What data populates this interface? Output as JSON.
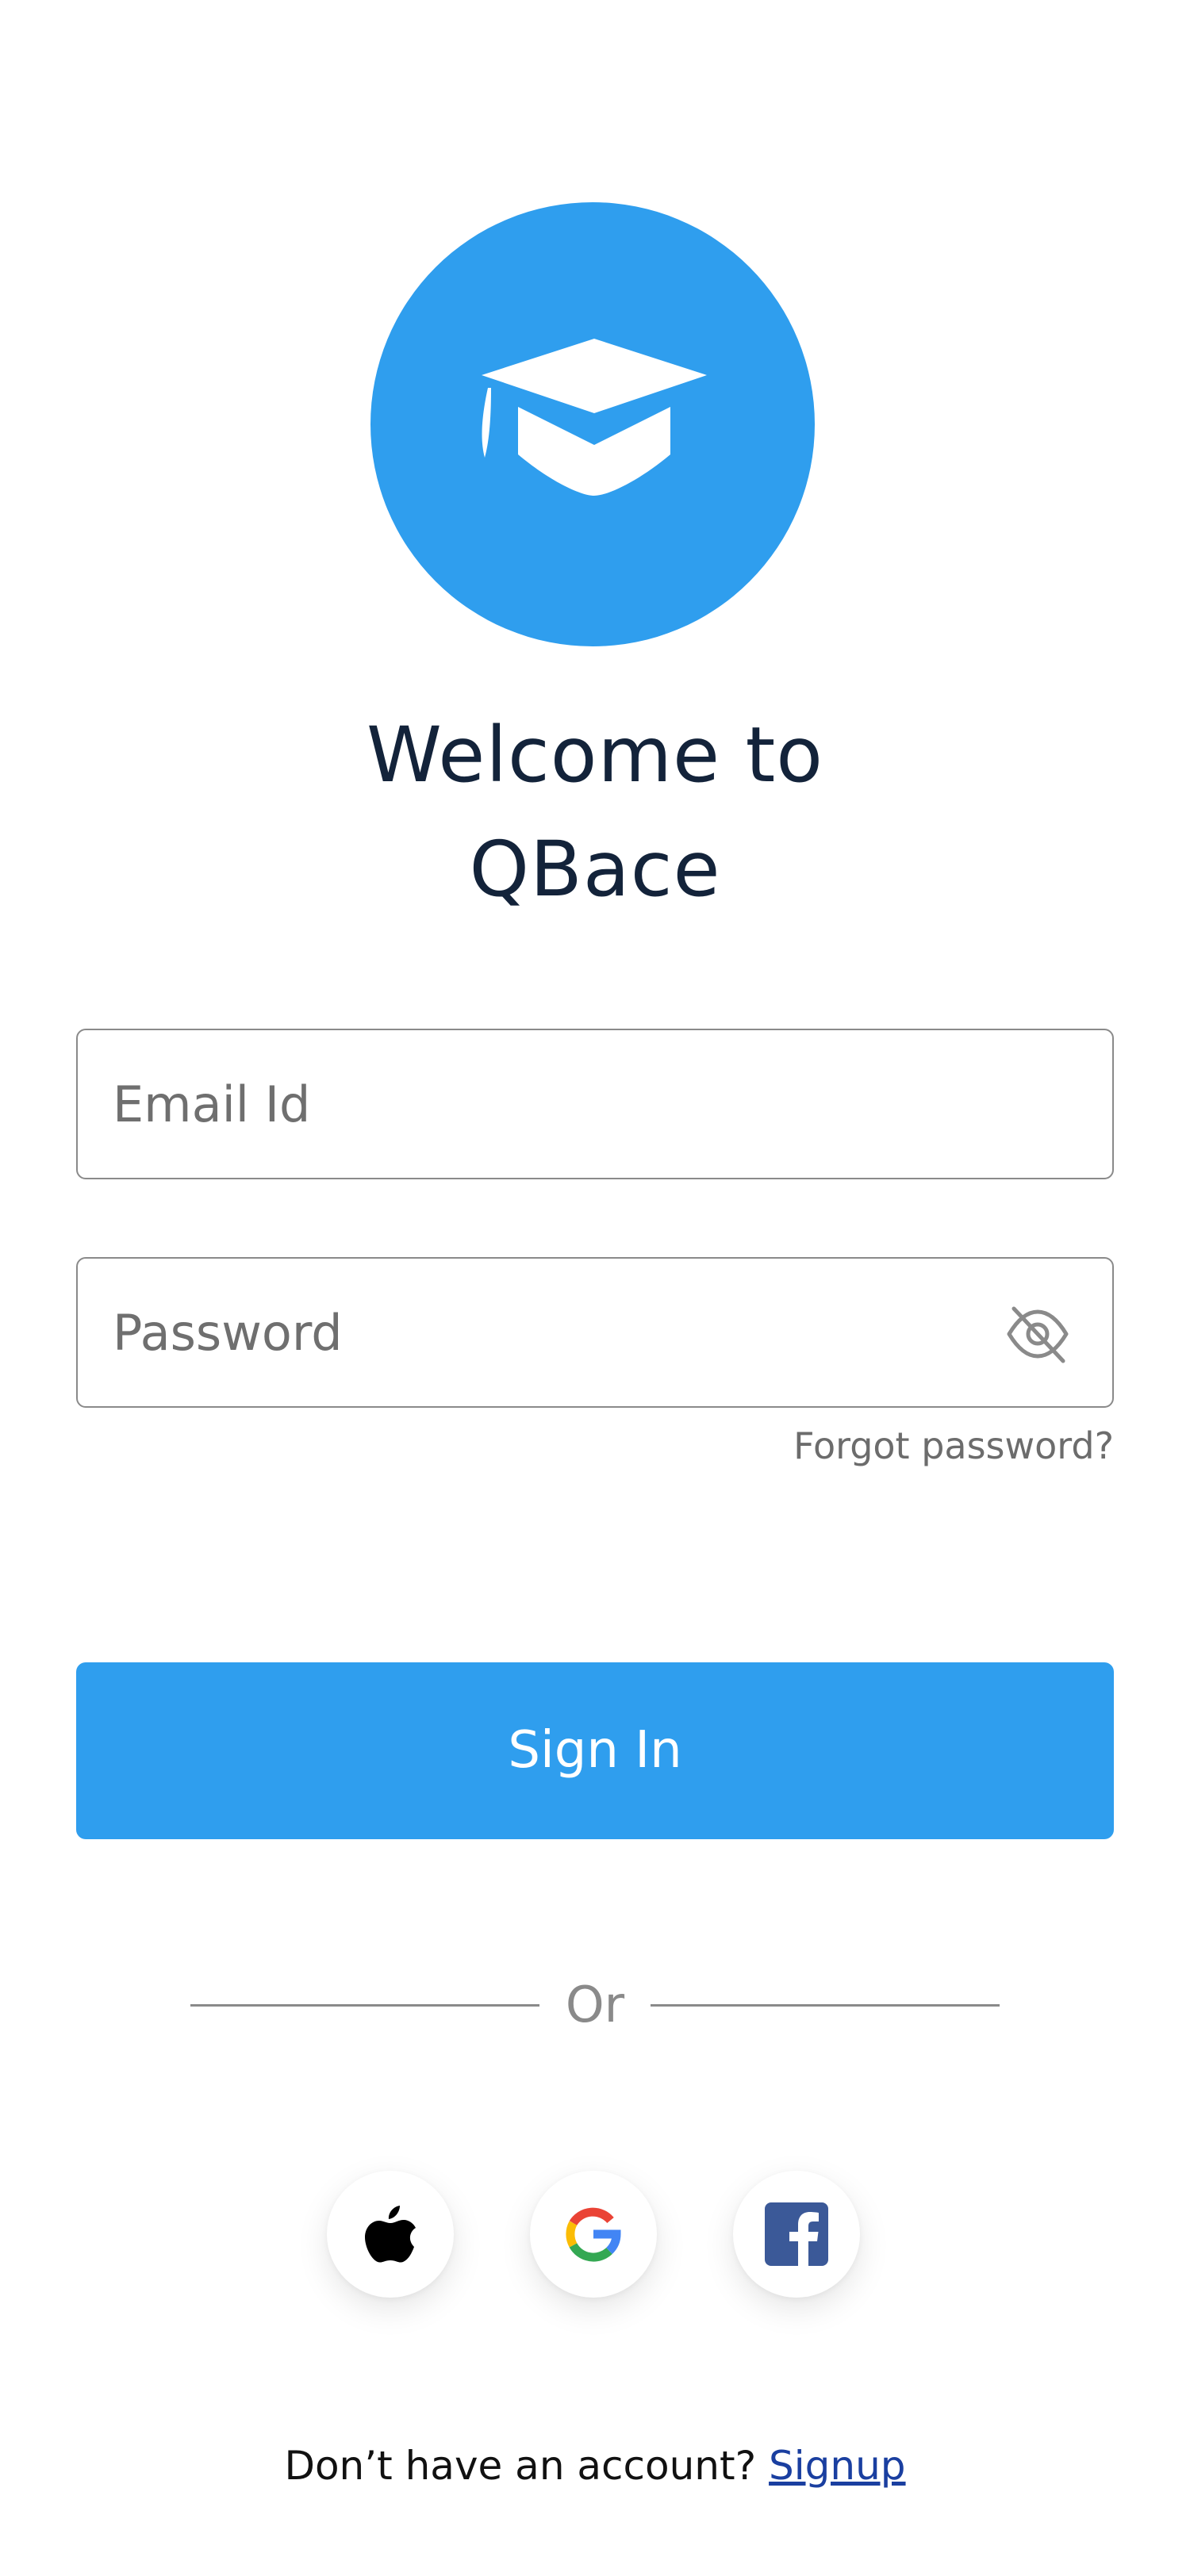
{
  "brand": {
    "accent_color": "#2f9eee",
    "logo_icon": "graduation-cap-icon"
  },
  "header": {
    "title_line1": "Welcome to",
    "title_line2": "QBace"
  },
  "form": {
    "email_placeholder": "Email Id",
    "password_placeholder": "Password",
    "password_toggle_icon": "eye-off-icon",
    "forgot_password": "Forgot password?",
    "sign_in_label": "Sign In"
  },
  "divider": {
    "label": "Or"
  },
  "social": [
    {
      "name": "apple",
      "icon": "apple-icon"
    },
    {
      "name": "google",
      "icon": "google-icon"
    },
    {
      "name": "facebook",
      "icon": "facebook-icon"
    }
  ],
  "footer": {
    "prompt": "Don’t have an account?",
    "signup_link": "Signup"
  }
}
